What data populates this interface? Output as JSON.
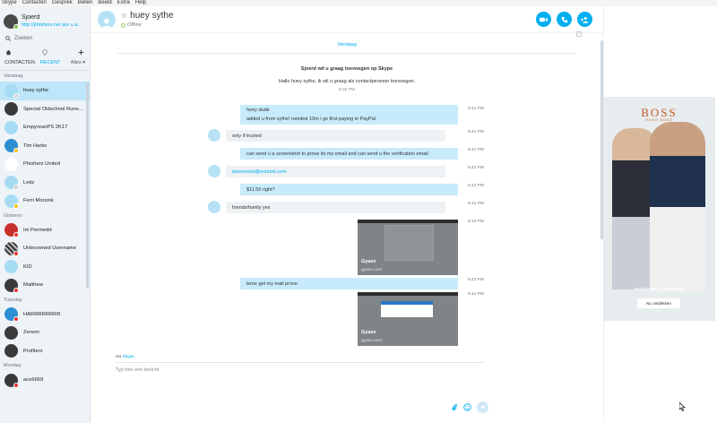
{
  "menu": [
    "Skype",
    "Contacten",
    "Gesprek",
    "Bellen",
    "Beeld",
    "Extra",
    "Help"
  ],
  "profile": {
    "name": "Sjoerd",
    "status_link": "http://phishers.net are u a..."
  },
  "search": {
    "placeholder": "Zoeken"
  },
  "tabs": {
    "contacts": "CONTACTEN",
    "recent": "RECENT",
    "filter": "Alles"
  },
  "groups": [
    {
      "label": "Vandaag",
      "contacts": [
        {
          "name": "huey sythe",
          "avatar": "default",
          "status": "gray",
          "active": true
        },
        {
          "name": "Special Oldschool Rune...",
          "avatar": "dark",
          "status": "none"
        },
        {
          "name": "EmpyreanPS 2K17",
          "avatar": "default",
          "status": "none"
        },
        {
          "name": "Tim Harks",
          "avatar": "blue",
          "status": "yellow"
        },
        {
          "name": "Phishers United",
          "avatar": "fish",
          "status": "none"
        },
        {
          "name": "Leitz",
          "avatar": "default",
          "status": "gray"
        },
        {
          "name": "Ferri Morsink",
          "avatar": "default",
          "status": "yellow"
        }
      ]
    },
    {
      "label": "Gisteren",
      "contacts": [
        {
          "name": "Im Permedd",
          "avatar": "red",
          "status": "red"
        },
        {
          "name": "Unknowned Username",
          "avatar": "pattern",
          "status": "red"
        },
        {
          "name": "KID",
          "avatar": "default",
          "status": "none"
        },
        {
          "name": "Matthew",
          "avatar": "dark",
          "status": "red"
        }
      ]
    },
    {
      "label": "Tuesday",
      "contacts": [
        {
          "name": "HARRRRRRRR",
          "avatar": "blue",
          "status": "red"
        },
        {
          "name": "Zenom",
          "avatar": "dark",
          "status": "none"
        },
        {
          "name": "Profiters",
          "avatar": "dark",
          "status": "none"
        }
      ]
    },
    {
      "label": "Monday",
      "contacts": [
        {
          "name": "aco6669",
          "avatar": "dark",
          "status": "red"
        }
      ]
    }
  ],
  "chat": {
    "name": "huey sythe",
    "status": "Offline",
    "date_separator": "Vandaag",
    "request_title": "Sjoerd wil u graag toevoegen op Skype",
    "request_text": "Hallo huey sythe, ik wil u graag als contactpersoon toevoegen.",
    "request_time": "6:40 PM",
    "messages": [
      {
        "dir": "out",
        "lines": [
          "heey dude",
          "added u from sythe! needed 10m i go first paying in PayPal"
        ],
        "time": "6:41 PM"
      },
      {
        "dir": "in",
        "lines": [
          "only if trusted"
        ],
        "time": "6:41 PM"
      },
      {
        "dir": "out",
        "lines": [
          "can send u a screenshot to prove its my email and can send u the verification email"
        ],
        "time": "6:41 PM"
      },
      {
        "dir": "in",
        "lines": [
          "iparessoot@outlook.com"
        ],
        "time": "6:42 PM",
        "link": true
      },
      {
        "dir": "out",
        "lines": [
          "$11.50 right?"
        ],
        "time": "6:42 PM"
      },
      {
        "dir": "in",
        "lines": [
          "friends/family yes"
        ],
        "time": "6:42 PM"
      },
      {
        "dir": "out",
        "image": true,
        "caption": "Gyazo",
        "source": "gyazo.com",
        "time": "6:43 PM"
      },
      {
        "dir": "out",
        "lines": [
          "leme get my mail prove"
        ],
        "time": "6:43 PM"
      },
      {
        "dir": "out",
        "image": true,
        "caption": "Gyazo",
        "source": "gyazo.com",
        "time": "6:44 PM"
      }
    ],
    "via_prefix": "via",
    "via_link": "Skype",
    "compose_placeholder": "Typ hier een bericht"
  },
  "ad": {
    "brand": "BOSS",
    "brand_sub": "HUGO BOSS",
    "tagline": "VOORJAAR / ZOMER 2017",
    "button": "Nu ontdekken"
  },
  "icons": {
    "search": "search-icon",
    "home": "home-icon",
    "add": "plus-icon",
    "video": "video-call-icon",
    "call": "phone-icon",
    "add_person": "add-person-icon",
    "attach": "paperclip-icon",
    "emoji": "emoji-icon",
    "send": "send-icon"
  },
  "colors": {
    "accent": "#00aff0",
    "bubble_out": "#c7ebfb",
    "bubble_in": "#eef2f5",
    "sidebar": "#eef3f8"
  }
}
